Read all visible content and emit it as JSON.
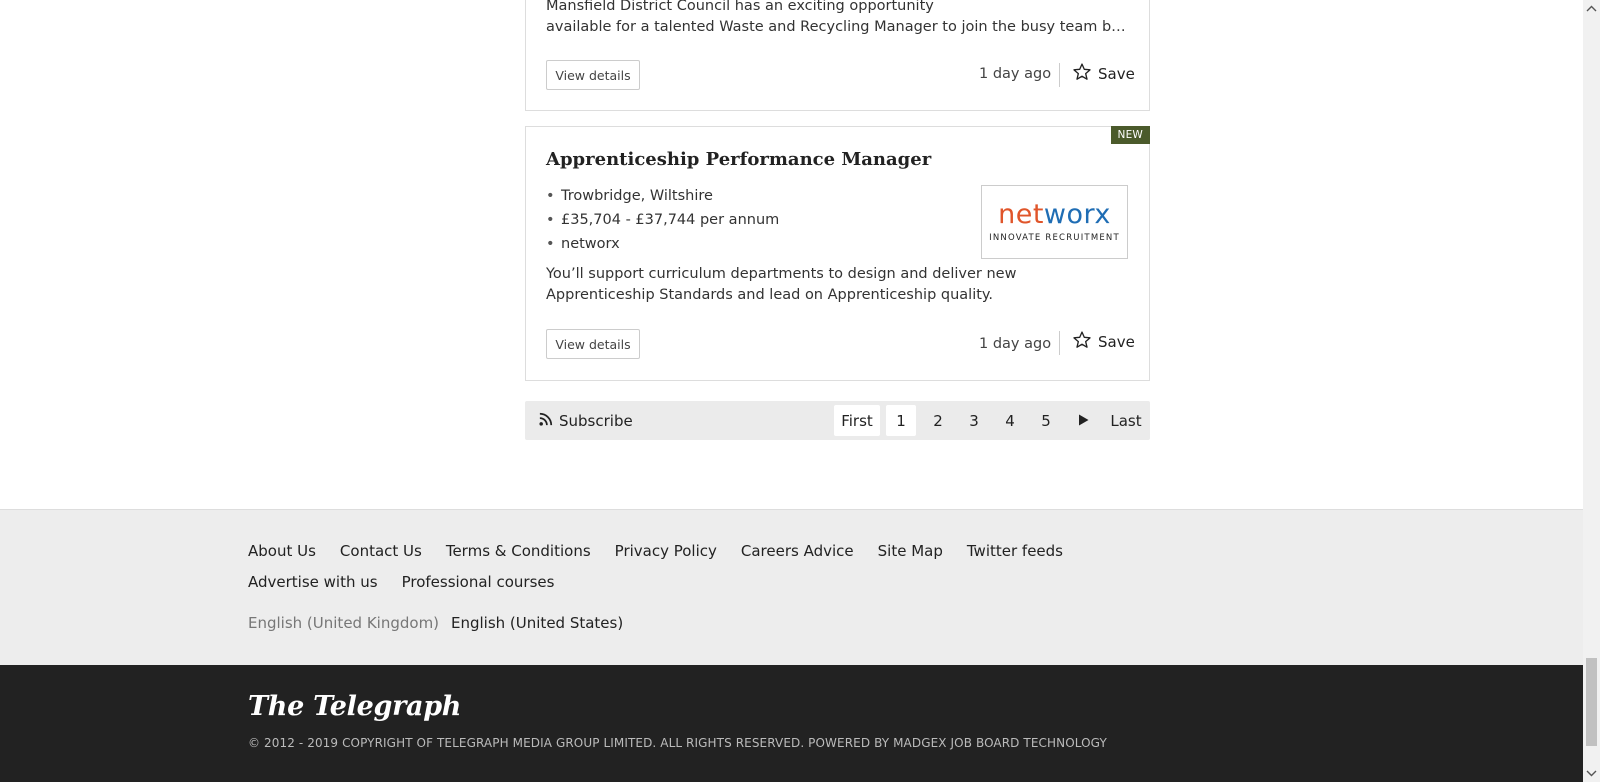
{
  "jobs": [
    {
      "description_line1": "Mansfield District Council has an exciting opportunity",
      "description_line2": "available for a talented Waste and Recycling Manager to join the busy team base...",
      "details_label": "View details",
      "posted": "1 day ago",
      "save_label": "Save"
    },
    {
      "badge": "NEW",
      "title": "Apprenticeship Performance Manager",
      "location": "Trowbridge, Wiltshire",
      "salary": "£35,704 - £37,744 per annum",
      "recruiter": "networx",
      "logo": {
        "word_part1": "net",
        "word_part2": "w",
        "word_part3": "o",
        "word_part4": "rx",
        "tagline": "INNOVATE RECRUITMENT",
        "color_orange": "#e0552a",
        "color_blue": "#1f6db4"
      },
      "description": "You’ll support curriculum departments to design and deliver new Apprenticeship Standards and lead on Apprenticeship quality.",
      "details_label": "View details",
      "posted": "1 day ago",
      "save_label": "Save"
    }
  ],
  "pagination": {
    "subscribe_label": "Subscribe",
    "first_label": "First",
    "pages": [
      "1",
      "2",
      "3",
      "4",
      "5"
    ],
    "current_page": "1",
    "last_label": "Last"
  },
  "footer": {
    "links": [
      "About Us",
      "Contact Us",
      "Terms & Conditions",
      "Privacy Policy",
      "Careers Advice",
      "Site Map",
      "Twitter feeds",
      "Advertise with us",
      "Professional courses"
    ],
    "lang_uk": "English (United Kingdom)",
    "lang_us": "English (United States)",
    "brand": "The Telegraph",
    "copyright": "© 2012 - 2019 COPYRIGHT OF TELEGRAPH MEDIA GROUP LIMITED. ALL RIGHTS RESERVED. POWERED BY MADGEX JOB BOARD TECHNOLOGY"
  },
  "colors": {
    "badge_new": "#4b5a2b",
    "footer_dark": "#222222",
    "footer_light": "#ededed"
  }
}
